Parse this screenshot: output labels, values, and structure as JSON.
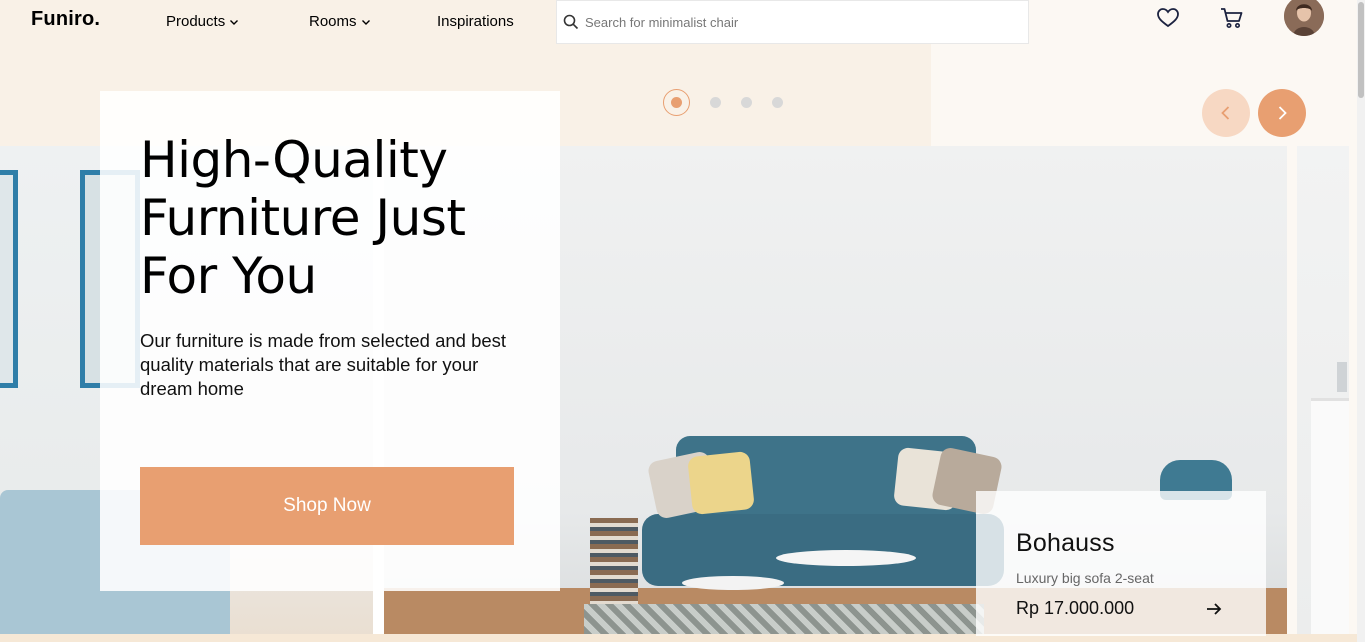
{
  "nav": {
    "logo": "Funiro.",
    "products_label": "Products",
    "rooms_label": "Rooms",
    "inspirations_label": "Inspirations",
    "search_placeholder": "Search for minimalist chair"
  },
  "slider": {
    "total_dots": 4,
    "active_index": 0
  },
  "hero": {
    "title": "High-Quality Furniture Just For You",
    "description": "Our furniture is made from selected and best quality materials that are suitable for your dream home",
    "cta_label": "Shop Now"
  },
  "product": {
    "name": "Bohauss",
    "subtitle": "Luxury big sofa 2-seat",
    "price": "Rp 17.000.000"
  },
  "icons": {
    "search": "search-icon",
    "wishlist": "heart-icon",
    "cart": "cart-icon",
    "prev": "chevron-left-icon",
    "next": "chevron-right-icon",
    "product_link": "arrow-right-icon",
    "dropdown": "chevron-down-icon"
  },
  "colors": {
    "accent": "#e89f71",
    "accent_light": "#f7d8c3",
    "header_bg": "#f9f1e7",
    "page_bg": "#fcf8f3"
  }
}
